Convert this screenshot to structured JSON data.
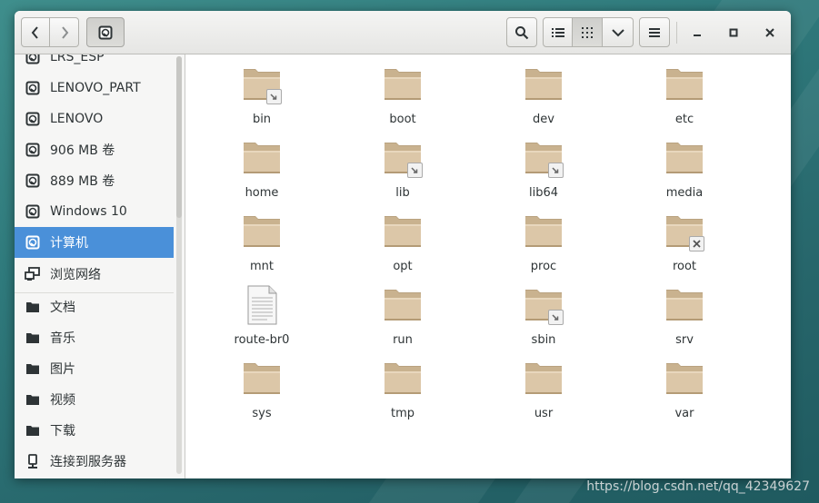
{
  "header": {
    "back_icon": "chevron-left-icon",
    "forward_icon": "chevron-right-icon",
    "location_icon": "drive-icon",
    "search_icon": "search-icon",
    "list_view_icon": "list-view-icon",
    "grid_view_icon": "grid-view-icon",
    "view_options_icon": "chevron-down-icon",
    "menu_icon": "hamburger-menu-icon",
    "minimize_icon": "minimize-icon",
    "maximize_icon": "maximize-icon",
    "close_icon": "close-icon"
  },
  "sidebar": {
    "items": [
      {
        "label": "LRS_ESP",
        "icon": "drive-icon"
      },
      {
        "label": "LENOVO_PART",
        "icon": "drive-icon"
      },
      {
        "label": "LENOVO",
        "icon": "drive-icon"
      },
      {
        "label": "906 MB 卷",
        "icon": "drive-icon"
      },
      {
        "label": "889 MB 卷",
        "icon": "drive-icon"
      },
      {
        "label": "Windows 10",
        "icon": "drive-icon"
      },
      {
        "label": "计算机",
        "icon": "drive-icon",
        "selected": true
      },
      {
        "label": "浏览网络",
        "icon": "network-icon"
      },
      {
        "label": "文档",
        "icon": "folder-icon"
      },
      {
        "label": "音乐",
        "icon": "folder-icon"
      },
      {
        "label": "图片",
        "icon": "folder-icon"
      },
      {
        "label": "视频",
        "icon": "folder-icon"
      },
      {
        "label": "下载",
        "icon": "folder-icon"
      },
      {
        "label": "连接到服务器",
        "icon": "server-icon"
      }
    ]
  },
  "files": [
    {
      "name": "bin",
      "type": "folder",
      "badge": "symlink"
    },
    {
      "name": "boot",
      "type": "folder",
      "badge": ""
    },
    {
      "name": "dev",
      "type": "folder",
      "badge": ""
    },
    {
      "name": "etc",
      "type": "folder",
      "badge": ""
    },
    {
      "name": "home",
      "type": "folder",
      "badge": ""
    },
    {
      "name": "lib",
      "type": "folder",
      "badge": "symlink"
    },
    {
      "name": "lib64",
      "type": "folder",
      "badge": "symlink"
    },
    {
      "name": "media",
      "type": "folder",
      "badge": ""
    },
    {
      "name": "mnt",
      "type": "folder",
      "badge": ""
    },
    {
      "name": "opt",
      "type": "folder",
      "badge": ""
    },
    {
      "name": "proc",
      "type": "folder",
      "badge": ""
    },
    {
      "name": "root",
      "type": "folder",
      "badge": "locked"
    },
    {
      "name": "route-br0",
      "type": "file",
      "badge": ""
    },
    {
      "name": "run",
      "type": "folder",
      "badge": ""
    },
    {
      "name": "sbin",
      "type": "folder",
      "badge": "symlink"
    },
    {
      "name": "srv",
      "type": "folder",
      "badge": ""
    },
    {
      "name": "sys",
      "type": "folder",
      "badge": ""
    },
    {
      "name": "tmp",
      "type": "folder",
      "badge": ""
    },
    {
      "name": "usr",
      "type": "folder",
      "badge": ""
    },
    {
      "name": "var",
      "type": "folder",
      "badge": ""
    }
  ],
  "watermark": "https://blog.csdn.net/qq_42349627",
  "colors": {
    "selection": "#4a90d9",
    "folder_body": "#dcc7a8",
    "folder_dark": "#b9a27f"
  }
}
